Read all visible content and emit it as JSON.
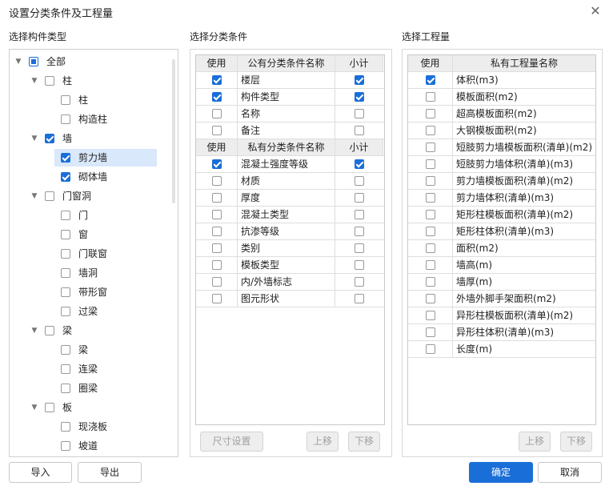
{
  "dialog": {
    "title": "设置分类条件及工程量"
  },
  "sections": {
    "component_type": "选择构件类型",
    "classification": "选择分类条件",
    "quantity": "选择工程量"
  },
  "tree": [
    {
      "label": "全部",
      "state": "partial",
      "level": 0,
      "arrow": true
    },
    {
      "label": "柱",
      "state": "unchecked",
      "level": 1,
      "arrow": true
    },
    {
      "label": "柱",
      "state": "unchecked",
      "level": 2,
      "arrow": false
    },
    {
      "label": "构造柱",
      "state": "unchecked",
      "level": 2,
      "arrow": false
    },
    {
      "label": "墙",
      "state": "checked",
      "level": 1,
      "arrow": true
    },
    {
      "label": "剪力墙",
      "state": "checked",
      "level": 2,
      "arrow": false,
      "selected": true
    },
    {
      "label": "砌体墙",
      "state": "checked",
      "level": 2,
      "arrow": false
    },
    {
      "label": "门窗洞",
      "state": "unchecked",
      "level": 1,
      "arrow": true
    },
    {
      "label": "门",
      "state": "unchecked",
      "level": 2,
      "arrow": false
    },
    {
      "label": "窗",
      "state": "unchecked",
      "level": 2,
      "arrow": false
    },
    {
      "label": "门联窗",
      "state": "unchecked",
      "level": 2,
      "arrow": false
    },
    {
      "label": "墙洞",
      "state": "unchecked",
      "level": 2,
      "arrow": false
    },
    {
      "label": "带形窗",
      "state": "unchecked",
      "level": 2,
      "arrow": false
    },
    {
      "label": "过梁",
      "state": "unchecked",
      "level": 2,
      "arrow": false
    },
    {
      "label": "梁",
      "state": "unchecked",
      "level": 1,
      "arrow": true
    },
    {
      "label": "梁",
      "state": "unchecked",
      "level": 2,
      "arrow": false
    },
    {
      "label": "连梁",
      "state": "unchecked",
      "level": 2,
      "arrow": false
    },
    {
      "label": "圈梁",
      "state": "unchecked",
      "level": 2,
      "arrow": false
    },
    {
      "label": "板",
      "state": "unchecked",
      "level": 1,
      "arrow": true
    },
    {
      "label": "现浇板",
      "state": "unchecked",
      "level": 2,
      "arrow": false
    },
    {
      "label": "坡道",
      "state": "unchecked",
      "level": 2,
      "arrow": false
    }
  ],
  "public_conditions": {
    "headers": [
      "使用",
      "公有分类条件名称",
      "小计"
    ],
    "rows": [
      {
        "use": true,
        "name": "楼层",
        "subtotal": true
      },
      {
        "use": true,
        "name": "构件类型",
        "subtotal": true
      },
      {
        "use": false,
        "name": "名称",
        "subtotal": false
      },
      {
        "use": false,
        "name": "备注",
        "subtotal": false
      }
    ]
  },
  "private_conditions": {
    "headers": [
      "使用",
      "私有分类条件名称",
      "小计"
    ],
    "rows": [
      {
        "use": true,
        "name": "混凝土强度等级",
        "subtotal": true
      },
      {
        "use": false,
        "name": "材质",
        "subtotal": false
      },
      {
        "use": false,
        "name": "厚度",
        "subtotal": false
      },
      {
        "use": false,
        "name": "混凝土类型",
        "subtotal": false
      },
      {
        "use": false,
        "name": "抗渗等级",
        "subtotal": false
      },
      {
        "use": false,
        "name": "类别",
        "subtotal": false
      },
      {
        "use": false,
        "name": "模板类型",
        "subtotal": false
      },
      {
        "use": false,
        "name": "内/外墙标志",
        "subtotal": false
      },
      {
        "use": false,
        "name": "图元形状",
        "subtotal": false
      }
    ]
  },
  "quantities": {
    "headers": [
      "使用",
      "私有工程量名称"
    ],
    "rows": [
      {
        "use": true,
        "name": "体积(m3)"
      },
      {
        "use": false,
        "name": "模板面积(m2)"
      },
      {
        "use": false,
        "name": "超高模板面积(m2)"
      },
      {
        "use": false,
        "name": "大钢模板面积(m2)"
      },
      {
        "use": false,
        "name": "短肢剪力墙模板面积(清单)(m2)"
      },
      {
        "use": false,
        "name": "短肢剪力墙体积(清单)(m3)"
      },
      {
        "use": false,
        "name": "剪力墙模板面积(清单)(m2)"
      },
      {
        "use": false,
        "name": "剪力墙体积(清单)(m3)"
      },
      {
        "use": false,
        "name": "矩形柱模板面积(清单)(m2)"
      },
      {
        "use": false,
        "name": "矩形柱体积(清单)(m3)"
      },
      {
        "use": false,
        "name": "面积(m2)"
      },
      {
        "use": false,
        "name": "墙高(m)"
      },
      {
        "use": false,
        "name": "墙厚(m)"
      },
      {
        "use": false,
        "name": "外墙外脚手架面积(m2)"
      },
      {
        "use": false,
        "name": "异形柱模板面积(清单)(m2)"
      },
      {
        "use": false,
        "name": "异形柱体积(清单)(m3)"
      },
      {
        "use": false,
        "name": "长度(m)"
      }
    ]
  },
  "buttons": {
    "size_settings": "尺寸设置",
    "move_up": "上移",
    "move_down": "下移",
    "import": "导入",
    "export": "导出",
    "ok": "确定",
    "cancel": "取消"
  },
  "colors": {
    "accent": "#1a6ed8",
    "selected_row": "#d9e8fb"
  }
}
